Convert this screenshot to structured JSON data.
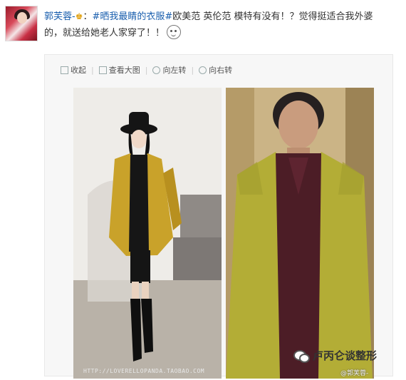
{
  "post": {
    "author": "郭芙蓉-",
    "crown_icon": "crown-icon",
    "topic": "#晒我最睛的衣服#",
    "body_line1": "欧美范 英伦范 模特有没有！？觉得挺适合我外婆",
    "body_line2": "的，就送给她老人家穿了！！"
  },
  "toolbar": {
    "collect": "收起",
    "view_large": "查看大图",
    "rotate_left": "向左转",
    "rotate_right": "向右转",
    "separator": "|"
  },
  "photos": {
    "left_caption": "HTTP://LOVERELLOPANDA.TAOBAO.COM",
    "right_credit": "@郭芙蓉-"
  },
  "brand": {
    "name": "卢丙仑谈整形",
    "icon": "wechat-icon"
  },
  "colors": {
    "link_blue": "#1a5fae",
    "coat_yellow": "#c9a22a",
    "coat_green_yellow": "#b3ad36"
  }
}
